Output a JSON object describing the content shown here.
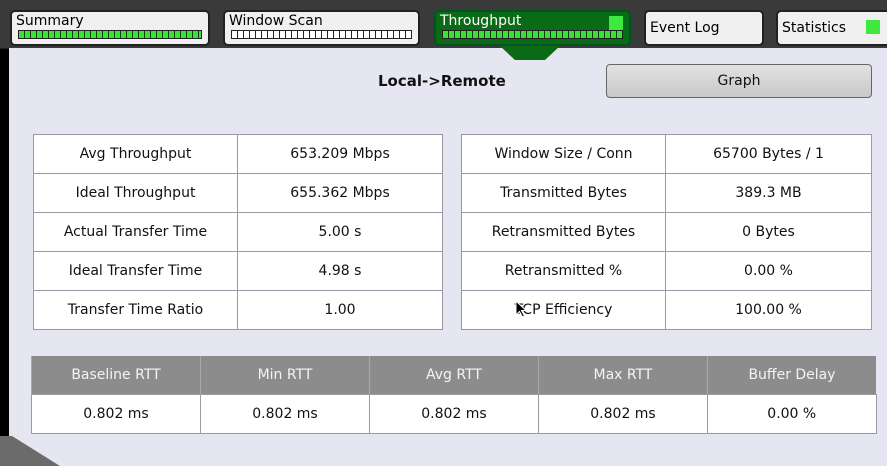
{
  "tabs": [
    {
      "label": "Summary",
      "bar": "green"
    },
    {
      "label": "Window Scan",
      "bar": "white"
    },
    {
      "label": "Throughput",
      "bar": "green",
      "active": true
    },
    {
      "label": "Event Log"
    },
    {
      "label": "Statistics"
    }
  ],
  "colors": {
    "active_tab": "#0a6a16",
    "indicator": "#3fe83f",
    "panel_bg": "#e6e6f2",
    "header_bg": "#8c8c8c"
  },
  "heading": "Local->Remote",
  "graph_button": "Graph",
  "left_table": [
    {
      "label": "Avg Throughput",
      "value": "653.209 Mbps"
    },
    {
      "label": "Ideal Throughput",
      "value": "655.362 Mbps"
    },
    {
      "label": "Actual Transfer Time",
      "value": "5.00 s"
    },
    {
      "label": "Ideal Transfer Time",
      "value": "4.98 s"
    },
    {
      "label": "Transfer Time Ratio",
      "value": "1.00"
    }
  ],
  "right_table": [
    {
      "label": "Window Size / Conn",
      "value": "65700 Bytes / 1"
    },
    {
      "label": "Transmitted Bytes",
      "value": "389.3 MB"
    },
    {
      "label": "Retransmitted Bytes",
      "value": "0 Bytes"
    },
    {
      "label": "Retransmitted %",
      "value": "0.00 %"
    },
    {
      "label": "TCP Efficiency",
      "value": "100.00 %"
    }
  ],
  "rtt": {
    "headers": [
      "Baseline RTT",
      "Min RTT",
      "Avg RTT",
      "Max RTT",
      "Buffer Delay"
    ],
    "values": [
      "0.802 ms",
      "0.802 ms",
      "0.802 ms",
      "0.802 ms",
      "0.00 %"
    ]
  }
}
